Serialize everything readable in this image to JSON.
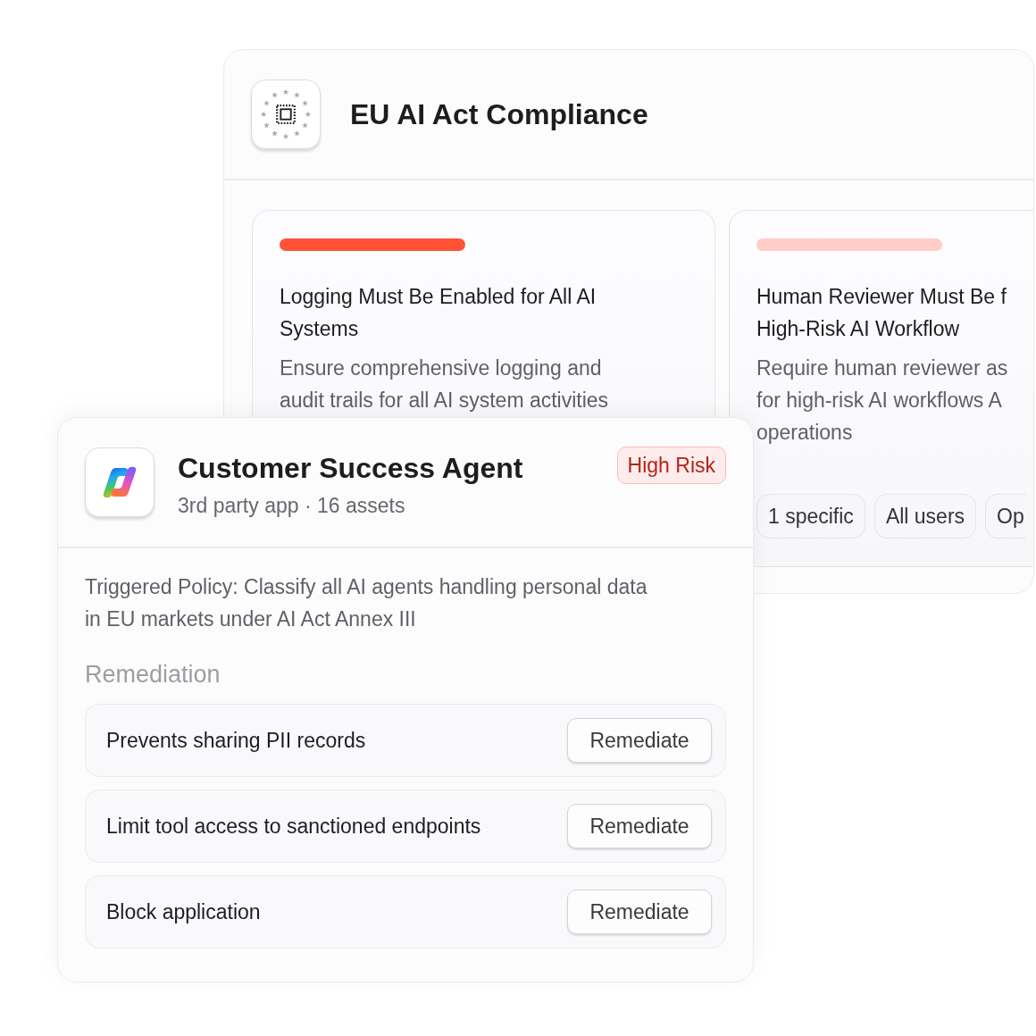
{
  "compliance_panel": {
    "title": "EU AI Act Compliance",
    "policies": [
      {
        "color": "#ff5236",
        "title": "Logging Must Be Enabled for All AI Systems",
        "description": "Ensure comprehensive logging and audit trails for all AI system activities"
      },
      {
        "color": "#ffcdc8",
        "title": "Human Reviewer Must Be f\nHigh-Risk AI Workflow",
        "description": "Require human reviewer as\nfor high-risk AI workflows A\noperations",
        "tags": [
          "1 specific",
          "All users",
          "Op"
        ]
      }
    ]
  },
  "agent_card": {
    "name": "Customer Success Agent",
    "subtitle": "3rd party app · 16 assets",
    "badge": "High Risk",
    "triggered_policy": "Triggered Policy: Classify all AI agents handling personal data in EU markets under AI Act Annex III",
    "section_title": "Remediation",
    "remediations": [
      {
        "label": "Prevents sharing PII records",
        "button": "Remediate"
      },
      {
        "label": "Limit tool access to sanctioned endpoints",
        "button": "Remediate"
      },
      {
        "label": "Block application",
        "button": "Remediate"
      }
    ]
  }
}
